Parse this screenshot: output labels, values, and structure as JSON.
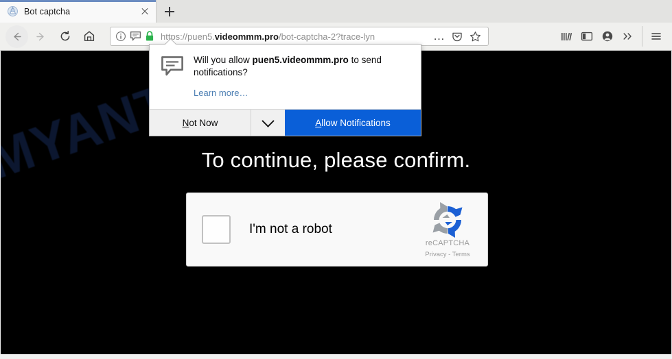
{
  "browser": {
    "tab": {
      "title": "Bot captcha",
      "favicon_name": "site-favicon",
      "close_label": "×"
    },
    "newtab_label": "+",
    "nav": {
      "back_label": "Back",
      "forward_label": "Forward",
      "reload_label": "Reload",
      "home_label": "Home"
    },
    "urlbar": {
      "protocol": "https://",
      "subdomain": "puen5.",
      "domain": "videommm.pro",
      "path": "/bot-captcha-2?trace-lyn",
      "full_url": "https://puen5.videommm.pro/bot-captcha-2?trace-lyn",
      "identity_icon": "info-icon",
      "notification_icon": "notification-bubble-icon",
      "lock_icon": "padlock-icon",
      "lock_color": "#2bb24c",
      "page_actions_label": "…",
      "pocket_label": "Save to Pocket",
      "bookmark_label": "Bookmark this page"
    },
    "toolbar_right": {
      "library_label": "Library",
      "sidebar_label": "Sidebar",
      "account_label": "Account",
      "overflow_label": "More tools",
      "menu_label": "Open menu"
    }
  },
  "permission_popup": {
    "icon_name": "notification-bubble-icon",
    "question_prefix": "Will you allow ",
    "question_origin": "puen5.videommm.pro",
    "question_suffix": " to send notifications?",
    "learn_more": "Learn more…",
    "not_now_accesskey": "N",
    "not_now_rest": "ot Now",
    "dropdown_icon": "chevron-down-icon",
    "allow_accesskey": "A",
    "allow_rest": "llow Notifications",
    "primary_color": "#0a5fd8"
  },
  "page": {
    "background_color": "#000000",
    "watermark_text": "MYANTISPYWARE.COM",
    "watermark_color": "#0c1730",
    "heading": "To continue, please confirm.",
    "heading_color": "#ffffff",
    "recaptcha": {
      "checkbox_name": "recaptcha-checkbox",
      "label": "I'm not a robot",
      "brand_name": "reCAPTCHA",
      "legal": "Privacy - Terms",
      "logo_name": "recaptcha-logo",
      "logo_blue": "#1c60d4",
      "logo_grey": "#9aa0a6"
    }
  }
}
